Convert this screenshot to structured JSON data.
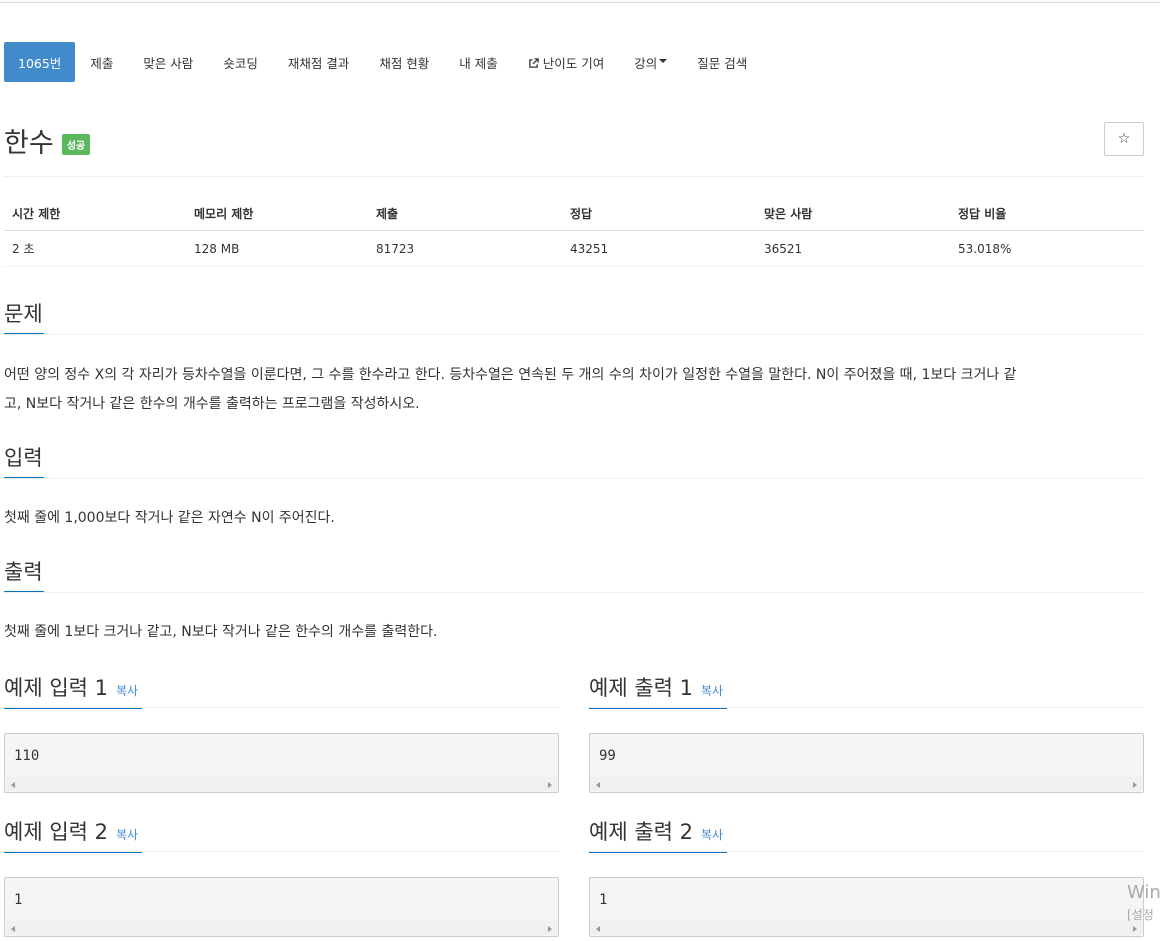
{
  "nav": {
    "tabs": [
      {
        "label": "1065번",
        "active": true
      },
      {
        "label": "제출"
      },
      {
        "label": "맞은 사람"
      },
      {
        "label": "숏코딩"
      },
      {
        "label": "재채점 결과"
      },
      {
        "label": "채점 현황"
      },
      {
        "label": "내 제출"
      },
      {
        "label": "난이도 기여",
        "icon": "external-link-icon"
      },
      {
        "label": "강의",
        "icon": "caret-down-icon"
      },
      {
        "label": "질문 검색"
      }
    ]
  },
  "problem": {
    "title": "한수",
    "status_badge": "성공",
    "star_icon": "☆"
  },
  "info_table": {
    "headers": [
      "시간 제한",
      "메모리 제한",
      "제출",
      "정답",
      "맞은 사람",
      "정답 비율"
    ],
    "values": [
      "2 초",
      "128 MB",
      "81723",
      "43251",
      "36521",
      "53.018%"
    ]
  },
  "sections": {
    "description": {
      "heading": "문제",
      "text_line1": "어떤 양의 정수 X의 각 자리가 등차수열을 이룬다면, 그 수를 한수라고 한다. 등차수열은 연속된 두 개의 수의 차이가 일정한 수열을 말한다. N이 주어졌을 때, 1보다 크거나 같",
      "text_line2": "고, N보다 작거나 같은 한수의 개수를 출력하는 프로그램을 작성하시오."
    },
    "input": {
      "heading": "입력",
      "text": "첫째 줄에 1,000보다 작거나 같은 자연수 N이 주어진다."
    },
    "output": {
      "heading": "출력",
      "text": "첫째 줄에 1보다 크거나 같고, N보다 작거나 같은 한수의 개수를 출력한다."
    }
  },
  "samples": {
    "copy_label": "복사",
    "in1": {
      "heading": "예제 입력 1",
      "value": "110"
    },
    "out1": {
      "heading": "예제 출력 1",
      "value": "99"
    },
    "in2": {
      "heading": "예제 입력 2",
      "value": "1"
    },
    "out2": {
      "heading": "예제 출력 2",
      "value": "1"
    }
  },
  "watermark": {
    "line1": "Win",
    "line2": "[설정"
  },
  "colors": {
    "accent": "#428bca",
    "success": "#5cb85c",
    "underline": "#0076c0"
  }
}
